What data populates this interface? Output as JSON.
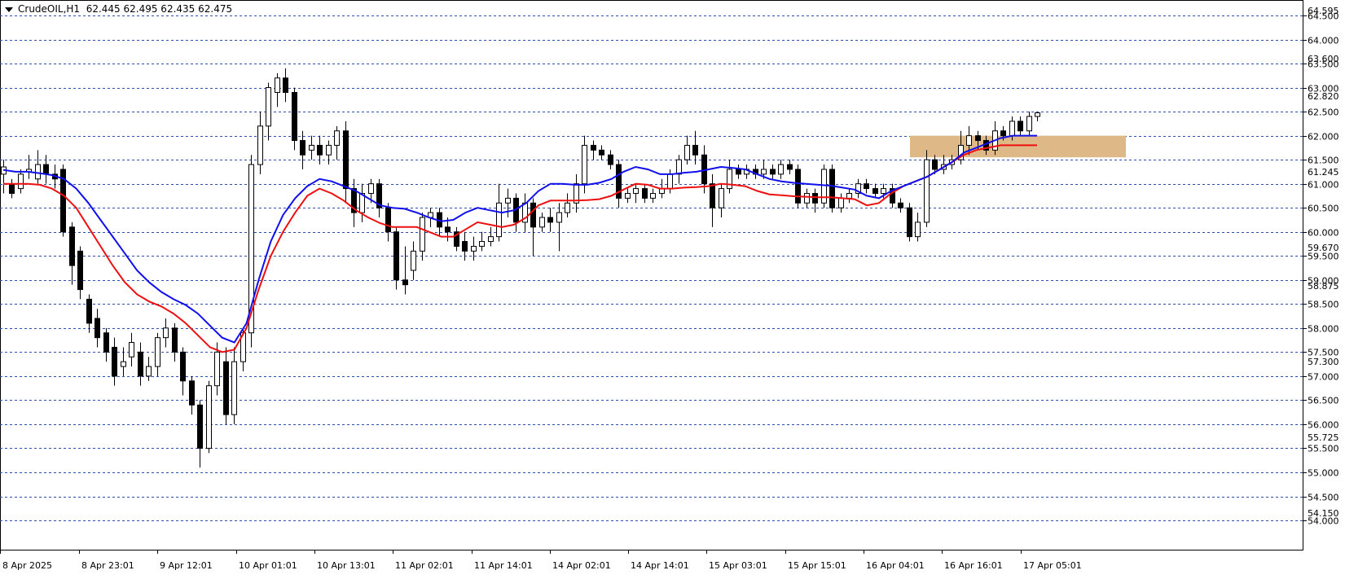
{
  "header": {
    "symbol": "CrudeOIL,H1",
    "ohlc": "62.445 62.495 62.435 62.475"
  },
  "chart_data": {
    "type": "candlestick",
    "title": "CrudeOIL,H1",
    "ylim": [
      54.0,
      64.5
    ],
    "grid": true,
    "price_axis_ticks": [
      "64.500",
      "64.000",
      "63.500",
      "63.000",
      "62.500",
      "62.000",
      "61.500",
      "61.000",
      "60.500",
      "60.000",
      "59.500",
      "59.000",
      "58.500",
      "58.000",
      "57.500",
      "57.000",
      "56.500",
      "56.000",
      "55.500",
      "55.000",
      "54.500",
      "54.000"
    ],
    "price_axis_minor_labels": [
      "64.595",
      "63.600",
      "62.820",
      "61.245",
      "59.670",
      "58.875",
      "57.300",
      "55.725",
      "54.150"
    ],
    "time_axis_labels": [
      "8 Apr 2025",
      "8 Apr 23:01",
      "9 Apr 12:01",
      "10 Apr 01:01",
      "10 Apr 13:01",
      "11 Apr 02:01",
      "11 Apr 14:01",
      "14 Apr 02:01",
      "14 Apr 14:01",
      "15 Apr 03:01",
      "15 Apr 15:01",
      "16 Apr 04:01",
      "16 Apr 16:01",
      "17 Apr 05:01"
    ],
    "colors": {
      "grid": "#2f4fb0",
      "bull_candle": "#ffffff",
      "bear_candle": "#000000",
      "ma_fast": "#1010ee",
      "ma_slow": "#ee1010",
      "zone": "#deb887"
    },
    "zone": {
      "price_low": 61.55,
      "price_high": 62.0
    },
    "ma_fast_points": [
      61.29,
      61.25,
      61.25,
      61.22,
      61.18,
      61.1,
      60.9,
      60.6,
      60.25,
      59.9,
      59.55,
      59.2,
      58.95,
      58.75,
      58.6,
      58.48,
      58.3,
      58.05,
      57.8,
      57.7,
      58.1,
      59.0,
      59.8,
      60.35,
      60.7,
      60.95,
      61.1,
      61.05,
      60.95,
      60.85,
      60.7,
      60.55,
      60.5,
      60.48,
      60.4,
      60.3,
      60.22,
      60.25,
      60.4,
      60.5,
      60.45,
      60.4,
      60.45,
      60.6,
      60.85,
      61.0,
      61.0,
      60.98,
      60.98,
      61.02,
      61.1,
      61.25,
      61.35,
      61.3,
      61.2,
      61.2,
      61.23,
      61.25,
      61.3,
      61.35,
      61.33,
      61.3,
      61.2,
      61.1,
      61.05,
      61.02,
      61.0,
      60.98,
      60.96,
      60.92,
      60.88,
      60.75,
      60.7,
      60.85,
      60.95,
      61.05,
      61.15,
      61.3,
      61.45,
      61.65,
      61.75,
      61.85,
      61.95,
      62.0,
      62.0,
      62.0
    ],
    "ma_slow_points": [
      61.0,
      61.0,
      61.0,
      60.98,
      60.9,
      60.75,
      60.5,
      60.1,
      59.7,
      59.3,
      58.95,
      58.7,
      58.55,
      58.45,
      58.3,
      58.1,
      57.85,
      57.6,
      57.5,
      57.55,
      58.0,
      58.8,
      59.5,
      60.0,
      60.4,
      60.75,
      60.9,
      60.8,
      60.65,
      60.45,
      60.3,
      60.18,
      60.1,
      60.1,
      60.1,
      60.0,
      59.9,
      59.9,
      60.05,
      60.2,
      60.15,
      60.1,
      60.15,
      60.3,
      60.55,
      60.65,
      60.65,
      60.65,
      60.66,
      60.68,
      60.75,
      60.88,
      61.0,
      60.98,
      60.9,
      60.9,
      60.92,
      60.93,
      60.95,
      61.0,
      60.98,
      60.95,
      60.85,
      60.78,
      60.76,
      60.74,
      60.73,
      60.72,
      60.72,
      60.7,
      60.68,
      60.55,
      60.6,
      60.8,
      60.95,
      61.05,
      61.15,
      61.3,
      61.45,
      61.6,
      61.7,
      61.75,
      61.8,
      61.8,
      61.8,
      61.8
    ],
    "candles": [
      [
        61.2,
        61.35,
        61.5,
        60.8
      ],
      [
        61.0,
        60.8,
        61.1,
        60.7
      ],
      [
        60.9,
        61.2,
        61.3,
        60.8
      ],
      [
        61.25,
        61.3,
        61.6,
        61.1
      ],
      [
        61.1,
        61.4,
        61.7,
        61.0
      ],
      [
        61.4,
        61.2,
        61.6,
        61.0
      ],
      [
        61.2,
        61.1,
        61.4,
        60.9
      ],
      [
        61.3,
        60.0,
        61.4,
        59.9
      ],
      [
        60.1,
        59.3,
        60.2,
        58.9
      ],
      [
        59.6,
        58.8,
        59.7,
        58.6
      ],
      [
        58.6,
        58.1,
        58.7,
        57.9
      ],
      [
        58.2,
        57.8,
        58.4,
        57.6
      ],
      [
        57.9,
        57.5,
        58.0,
        57.3
      ],
      [
        57.6,
        57.0,
        57.8,
        56.8
      ],
      [
        57.2,
        57.3,
        57.6,
        57.0
      ],
      [
        57.4,
        57.7,
        57.9,
        57.2
      ],
      [
        57.5,
        57.0,
        57.7,
        56.8
      ],
      [
        57.0,
        57.2,
        57.4,
        56.9
      ],
      [
        57.2,
        57.8,
        57.9,
        57.0
      ],
      [
        57.8,
        58.0,
        58.2,
        57.6
      ],
      [
        58.0,
        57.5,
        58.1,
        57.3
      ],
      [
        57.5,
        56.9,
        57.6,
        56.6
      ],
      [
        56.9,
        56.4,
        57.0,
        56.2
      ],
      [
        56.4,
        55.5,
        56.5,
        55.1
      ],
      [
        55.5,
        56.8,
        56.9,
        55.4
      ],
      [
        56.8,
        57.5,
        57.7,
        56.6
      ],
      [
        57.3,
        56.2,
        57.6,
        56.0
      ],
      [
        56.2,
        57.3,
        57.6,
        56.0
      ],
      [
        57.3,
        57.9,
        58.0,
        57.1
      ],
      [
        57.9,
        61.4,
        61.6,
        57.6
      ],
      [
        61.4,
        62.2,
        62.5,
        61.2
      ],
      [
        62.2,
        63.0,
        63.1,
        61.9
      ],
      [
        62.9,
        63.2,
        63.3,
        62.6
      ],
      [
        63.2,
        62.9,
        63.4,
        62.7
      ],
      [
        62.9,
        61.9,
        63.0,
        61.7
      ],
      [
        61.9,
        61.6,
        62.1,
        61.3
      ],
      [
        61.7,
        61.8,
        62.0,
        61.5
      ],
      [
        61.8,
        61.6,
        62.0,
        61.4
      ],
      [
        61.6,
        61.8,
        61.9,
        61.4
      ],
      [
        61.8,
        62.1,
        62.2,
        61.5
      ],
      [
        62.1,
        60.9,
        62.3,
        60.6
      ],
      [
        60.9,
        60.4,
        61.1,
        60.1
      ],
      [
        60.4,
        60.8,
        61.0,
        60.2
      ],
      [
        60.8,
        61.0,
        61.1,
        60.6
      ],
      [
        61.0,
        60.5,
        61.1,
        60.3
      ],
      [
        60.5,
        60.0,
        60.6,
        59.8
      ],
      [
        60.0,
        59.0,
        60.1,
        58.8
      ],
      [
        59.0,
        58.9,
        59.7,
        58.7
      ],
      [
        59.2,
        59.6,
        59.8,
        59.0
      ],
      [
        59.6,
        60.3,
        60.4,
        59.4
      ],
      [
        60.3,
        60.4,
        60.5,
        60.1
      ],
      [
        60.4,
        60.1,
        60.5,
        59.9
      ],
      [
        60.1,
        60.0,
        60.3,
        59.8
      ],
      [
        60.0,
        59.7,
        60.1,
        59.6
      ],
      [
        59.8,
        59.6,
        60.0,
        59.4
      ],
      [
        59.6,
        59.7,
        59.9,
        59.4
      ],
      [
        59.7,
        59.8,
        60.0,
        59.6
      ],
      [
        59.8,
        59.9,
        60.1,
        59.7
      ],
      [
        59.9,
        60.6,
        61.0,
        59.8
      ],
      [
        60.6,
        60.7,
        60.9,
        60.3
      ],
      [
        60.7,
        60.2,
        60.8,
        60.0
      ],
      [
        60.2,
        60.6,
        60.8,
        60.0
      ],
      [
        60.6,
        60.1,
        60.7,
        59.5
      ],
      [
        60.1,
        60.3,
        60.4,
        60.0
      ],
      [
        60.3,
        60.2,
        60.5,
        60.0
      ],
      [
        60.2,
        60.4,
        60.6,
        59.6
      ],
      [
        60.4,
        60.6,
        60.8,
        60.3
      ],
      [
        60.6,
        61.0,
        61.2,
        60.4
      ],
      [
        61.0,
        61.8,
        62.0,
        60.8
      ],
      [
        61.8,
        61.7,
        61.9,
        61.5
      ],
      [
        61.7,
        61.6,
        61.8,
        61.5
      ],
      [
        61.6,
        61.4,
        61.7,
        61.3
      ],
      [
        61.4,
        60.7,
        61.5,
        60.5
      ],
      [
        60.7,
        60.8,
        60.9,
        60.6
      ],
      [
        60.8,
        60.9,
        61.0,
        60.6
      ],
      [
        60.9,
        60.7,
        61.0,
        60.6
      ],
      [
        60.7,
        60.8,
        60.9,
        60.6
      ],
      [
        60.8,
        60.9,
        61.1,
        60.7
      ],
      [
        60.9,
        61.2,
        61.3,
        60.8
      ],
      [
        61.2,
        61.5,
        61.6,
        61.0
      ],
      [
        61.5,
        61.8,
        62.0,
        61.4
      ],
      [
        61.8,
        61.6,
        62.1,
        61.4
      ],
      [
        61.6,
        61.0,
        61.8,
        60.8
      ],
      [
        61.0,
        60.5,
        61.2,
        60.1
      ],
      [
        60.5,
        60.9,
        61.0,
        60.3
      ],
      [
        60.9,
        61.3,
        61.5,
        60.8
      ],
      [
        61.3,
        61.2,
        61.4,
        61.1
      ],
      [
        61.2,
        61.3,
        61.4,
        61.1
      ],
      [
        61.3,
        61.2,
        61.4,
        61.1
      ],
      [
        61.2,
        61.3,
        61.5,
        61.1
      ],
      [
        61.3,
        61.2,
        61.4,
        61.1
      ],
      [
        61.2,
        61.4,
        61.5,
        61.1
      ],
      [
        61.4,
        61.3,
        61.5,
        61.2
      ],
      [
        61.3,
        60.6,
        61.4,
        60.5
      ],
      [
        60.6,
        60.8,
        60.9,
        60.5
      ],
      [
        60.8,
        60.6,
        60.9,
        60.4
      ],
      [
        60.6,
        61.3,
        61.4,
        60.5
      ],
      [
        61.3,
        60.5,
        61.4,
        60.4
      ],
      [
        60.5,
        60.7,
        60.8,
        60.4
      ],
      [
        60.7,
        60.8,
        60.9,
        60.6
      ],
      [
        60.8,
        61.0,
        61.1,
        60.7
      ],
      [
        61.0,
        60.9,
        61.1,
        60.8
      ],
      [
        60.9,
        60.8,
        61.0,
        60.7
      ],
      [
        60.8,
        60.9,
        61.0,
        60.7
      ],
      [
        60.9,
        60.6,
        61.0,
        60.5
      ],
      [
        60.6,
        60.5,
        60.7,
        60.4
      ],
      [
        60.5,
        59.9,
        60.6,
        59.8
      ],
      [
        59.9,
        60.2,
        60.4,
        59.8
      ],
      [
        60.2,
        61.5,
        61.7,
        60.1
      ],
      [
        61.5,
        61.3,
        61.6,
        61.2
      ],
      [
        61.3,
        61.4,
        61.6,
        61.2
      ],
      [
        61.4,
        61.5,
        61.6,
        61.3
      ],
      [
        61.5,
        61.8,
        62.1,
        61.4
      ],
      [
        61.8,
        62.0,
        62.2,
        61.6
      ],
      [
        62.0,
        61.9,
        62.1,
        61.7
      ],
      [
        61.9,
        61.7,
        62.0,
        61.6
      ],
      [
        61.7,
        62.1,
        62.3,
        61.6
      ],
      [
        62.1,
        62.0,
        62.2,
        61.9
      ],
      [
        62.0,
        62.3,
        62.4,
        61.9
      ],
      [
        62.3,
        62.1,
        62.4,
        62.0
      ],
      [
        62.1,
        62.4,
        62.5,
        62.0
      ],
      [
        62.4,
        62.475,
        62.5,
        62.3
      ]
    ]
  }
}
